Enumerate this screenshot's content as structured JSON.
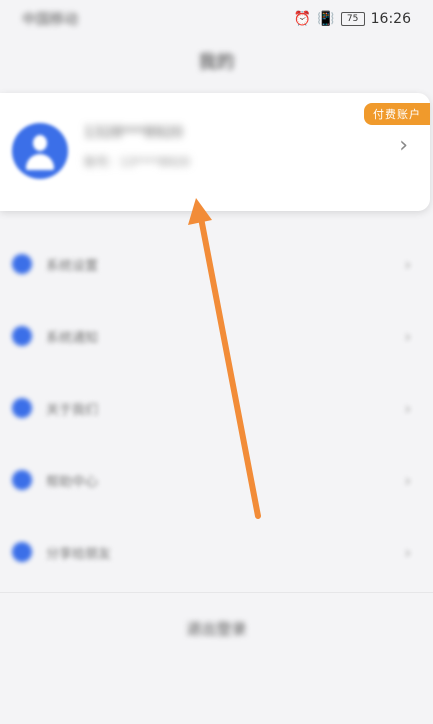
{
  "status_bar": {
    "carrier": "中国移动",
    "battery": "75",
    "time": "16:26"
  },
  "header": {
    "title": "我的"
  },
  "account": {
    "badge": "付费账户",
    "phone": "1328***8920",
    "sub": "账号：13****8920"
  },
  "menu": {
    "items": [
      {
        "label": "系统设置",
        "icon": "settings-icon"
      },
      {
        "label": "系统通知",
        "icon": "notice-icon"
      },
      {
        "label": "关于我们",
        "icon": "info-icon"
      },
      {
        "label": "帮助中心",
        "icon": "help-icon"
      },
      {
        "label": "分享给朋友",
        "icon": "share-icon"
      }
    ]
  },
  "logout_label": "退出登录",
  "colors": {
    "accent": "#3b6fe8",
    "badge": "#f09a2c",
    "arrow": "#f28c38"
  }
}
